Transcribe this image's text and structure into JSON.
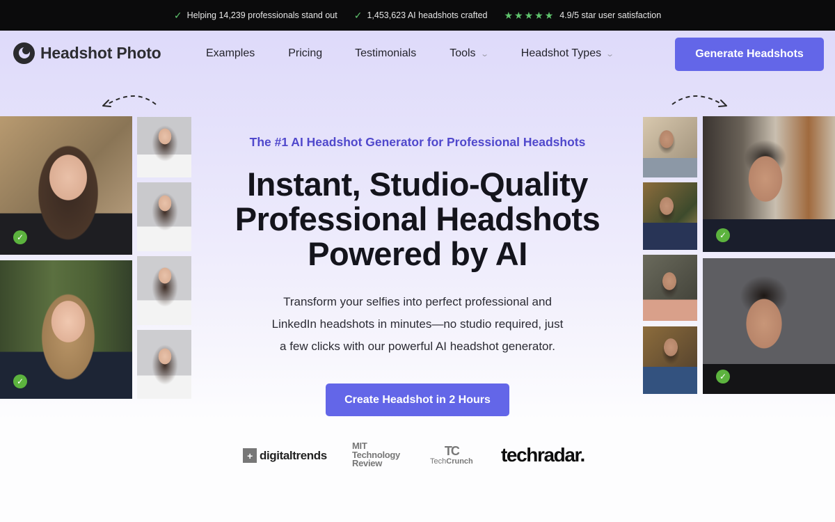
{
  "topbar": {
    "items": [
      {
        "icon": "check-icon",
        "text": "Helping 14,239 professionals stand out"
      },
      {
        "icon": "check-icon",
        "text": "1,453,623 AI headshots crafted"
      }
    ],
    "rating": {
      "stars": 5,
      "max_stars": 5,
      "text": "4.9/5 star user satisfaction"
    },
    "accent_color": "#5fc46d"
  },
  "nav": {
    "brand": "Headshot Photo",
    "links": [
      {
        "label": "Examples",
        "has_dropdown": false
      },
      {
        "label": "Pricing",
        "has_dropdown": false
      },
      {
        "label": "Testimonials",
        "has_dropdown": false
      },
      {
        "label": "Tools",
        "has_dropdown": true
      },
      {
        "label": "Headshot Types",
        "has_dropdown": true
      }
    ],
    "cta_label": "Generate Headshots"
  },
  "hero": {
    "tagline": "The #1 AI Headshot Generator for Professional Headshots",
    "headline_lines": [
      "Instant, Studio-Quality",
      "Professional Headshots",
      "Powered by AI"
    ],
    "subtext_lines": [
      "Transform your selfies into perfect professional and",
      "LinkedIn headshots in minutes—no studio required, just",
      "a few clicks with our powerful AI headshot generator."
    ],
    "cta_label": "Create Headshot in 2 Hours"
  },
  "gallery": {
    "left": {
      "generated": [
        {
          "alt": "Woman in black blazer, smiling, autumn background",
          "verified": true
        },
        {
          "alt": "Blonde woman in navy dress, forest background",
          "verified": true
        }
      ],
      "selfies": [
        {
          "alt": "Woman thinking, hand on chin"
        },
        {
          "alt": "Woman surprised, hands on face"
        },
        {
          "alt": "Woman looking sideways"
        },
        {
          "alt": "Woman laughing"
        }
      ]
    },
    "right": {
      "selfies": [
        {
          "alt": "Man with glasses in grey sweater"
        },
        {
          "alt": "Man in varsity jacket, smiling"
        },
        {
          "alt": "Man in striped kurta"
        },
        {
          "alt": "Man in blue kurta"
        }
      ],
      "generated": [
        {
          "alt": "Man with glasses in navy sweater, office background",
          "verified": true
        },
        {
          "alt": "Man with glasses in black turtleneck, grey background",
          "verified": true
        }
      ]
    }
  },
  "press": {
    "logos": [
      {
        "name": "digitaltrends",
        "text": "digitaltrends"
      },
      {
        "name": "mit-technology-review",
        "lines": [
          "MIT",
          "Technology",
          "Review"
        ]
      },
      {
        "name": "techcrunch",
        "mark": "TC",
        "text_light": "Tech",
        "text_bold": "Crunch"
      },
      {
        "name": "techradar",
        "text": "techradar."
      }
    ]
  },
  "colors": {
    "primary": "#6366e8",
    "tagline": "#5048cc",
    "verified": "#5cb33e"
  }
}
